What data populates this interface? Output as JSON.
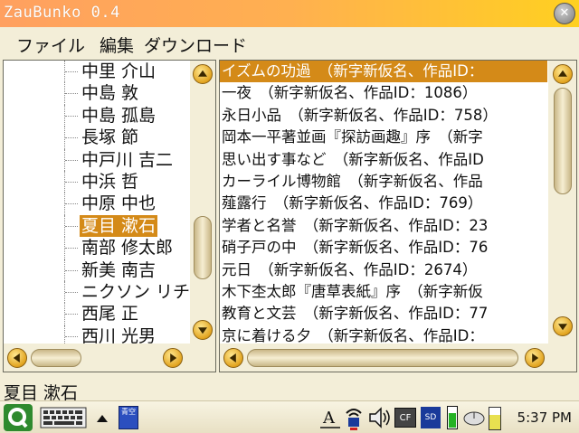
{
  "window": {
    "title": "ZauBunko 0.4",
    "close_symbol": "✕"
  },
  "menu": [
    "ファイル",
    "編集",
    "ダウンロード"
  ],
  "authors": [
    "中里 介山",
    "中島 敦",
    "中島 孤島",
    "長塚 節",
    "中戸川 吉二",
    "中浜 哲",
    "中原 中也",
    "夏目 漱石",
    "南部 修太郎",
    "新美 南吉",
    "ニクソン リチ",
    "西尾 正",
    "西川 光男"
  ],
  "selected_author_index": 7,
  "works": [
    "イズムの功過　（新字新仮名、作品ID：",
    "一夜　（新字新仮名、作品ID：1086）",
    "永日小品　（新字新仮名、作品ID：758）",
    "岡本一平著並画『探訪画趣』序　（新字",
    "思い出す事など　（新字新仮名、作品ID",
    "カーライル博物館　（新字新仮名、作品",
    "薤露行　（新字新仮名、作品ID：769）",
    "学者と名誉　（新字新仮名、作品ID：23",
    "硝子戸の中　（新字新仮名、作品ID：76",
    "元日　（新字新仮名、作品ID：2674）",
    "木下杢太郎『唐草表紙』序　（新字新仮",
    "教育と文芸　（新字新仮名、作品ID：77",
    "京に着ける夕　（新字新仮名、作品ID："
  ],
  "selected_work_index": 0,
  "status_text": "夏目 漱石",
  "taskbar": {
    "clock": "5:37 PM",
    "icons": [
      "q-launcher-icon",
      "keyboard-icon",
      "up-arrow-icon",
      "book-app-icon",
      "text-input-icon",
      "wireless-icon",
      "volume-icon",
      "cf-card-icon",
      "sd-card-icon",
      "battery-icon",
      "mouse-icon",
      "light-icon"
    ],
    "cf_label": "CF",
    "sd_label": "SD",
    "book_label": "青空"
  },
  "colors": {
    "selection": "#d48a18",
    "title_gradient_start": "#ffa060",
    "title_gradient_end": "#ffd020",
    "background": "#f3eed8"
  }
}
